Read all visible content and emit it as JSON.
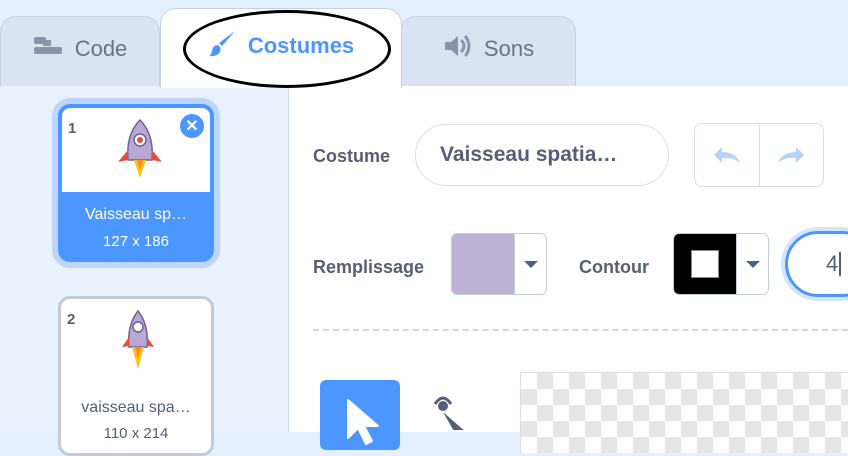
{
  "tabs": {
    "code_label": "Code",
    "costumes_label": "Costumes",
    "sounds_label": "Sons"
  },
  "costumes": [
    {
      "number": "1",
      "name": "Vaisseau sp…",
      "size": "127 x 186",
      "selected": true
    },
    {
      "number": "2",
      "name": "vaisseau spa…",
      "size": "110 x 214",
      "selected": false
    }
  ],
  "editor": {
    "costume_label": "Costume",
    "costume_name": "Vaisseau spatia…",
    "fill_label": "Remplissage",
    "fill_color": "#beb1d6",
    "outline_label": "Contour",
    "outline_color": "#000000",
    "outline_width": "4"
  },
  "colors": {
    "accent": "#4c97ff",
    "tab_bg": "#d9e3f2",
    "panel_bg": "#e9f1fc"
  },
  "icons": [
    "code-icon",
    "brush-icon",
    "speaker-icon",
    "delete-icon",
    "undo-icon",
    "redo-icon",
    "select-arrow-icon",
    "reshape-icon",
    "rocket-icon"
  ]
}
